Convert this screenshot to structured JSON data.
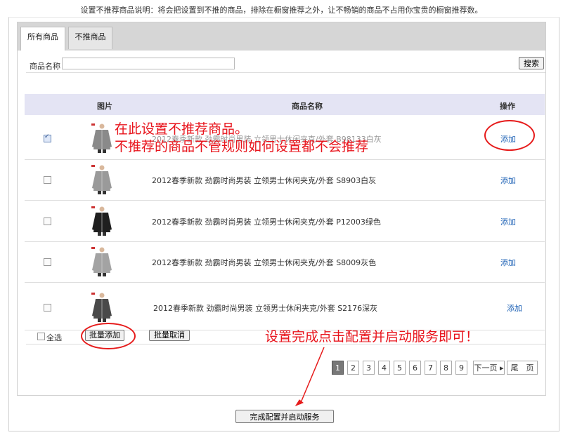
{
  "top_note": "设置不推荐商品说明：将会把设置到不推的商品，排除在橱窗推荐之外，让不畅销的商品不占用你宝贵的橱窗推荐数。",
  "tabs": [
    {
      "label": "所有商品"
    },
    {
      "label": "不推商品"
    }
  ],
  "search": {
    "label": "商品名称",
    "value": "",
    "button": "搜索"
  },
  "table": {
    "headers": {
      "image": "图片",
      "name": "商品名称",
      "action": "操作"
    },
    "rows": [
      {
        "name": "2012春季新款 劲霸时尚男装 立领男士休闲夹克/外套 B98133白灰",
        "action": "添加",
        "checked": true,
        "jacket_color": "#8a8a8a"
      },
      {
        "name": "2012春季新款 劲霸时尚男装 立领男士休闲夹克/外套 S8903白灰",
        "action": "添加",
        "checked": false,
        "jacket_color": "#9a9a9a"
      },
      {
        "name": "2012春季新款 劲霸时尚男装 立领男士休闲夹克/外套 P12003绿色",
        "action": "添加",
        "checked": false,
        "jacket_color": "#1f1f1f"
      },
      {
        "name": "2012春季新款 劲霸时尚男装 立领男士休闲夹克/外套 S8009灰色",
        "action": "添加",
        "checked": false,
        "jacket_color": "#a3a3a3"
      },
      {
        "name": "2012春季新款 劲霸时尚男装 立领男士休闲夹克/外套 S2176深灰",
        "action": "添加",
        "checked": false,
        "jacket_color": "#4a4a4a"
      }
    ]
  },
  "footer": {
    "select_all": "全选",
    "batch_add": "批量添加",
    "batch_cancel": "批量取消"
  },
  "pagination": {
    "pages": [
      "1",
      "2",
      "3",
      "4",
      "5",
      "6",
      "7",
      "8",
      "9"
    ],
    "current": "1",
    "next": "下一页",
    "last": "尾　页"
  },
  "annotations": {
    "line1": "在此设置不推荐商品。",
    "line2": "不推荐的商品不管规则如何设置都不会推荐",
    "line3": "设置完成点击配置并启动服务即可！"
  },
  "complete_button": "完成配置并启动服务",
  "colors": {
    "annotation_red": "#e8141c",
    "link_blue": "#1a5fb4",
    "header_bg": "#e4e4f4"
  }
}
